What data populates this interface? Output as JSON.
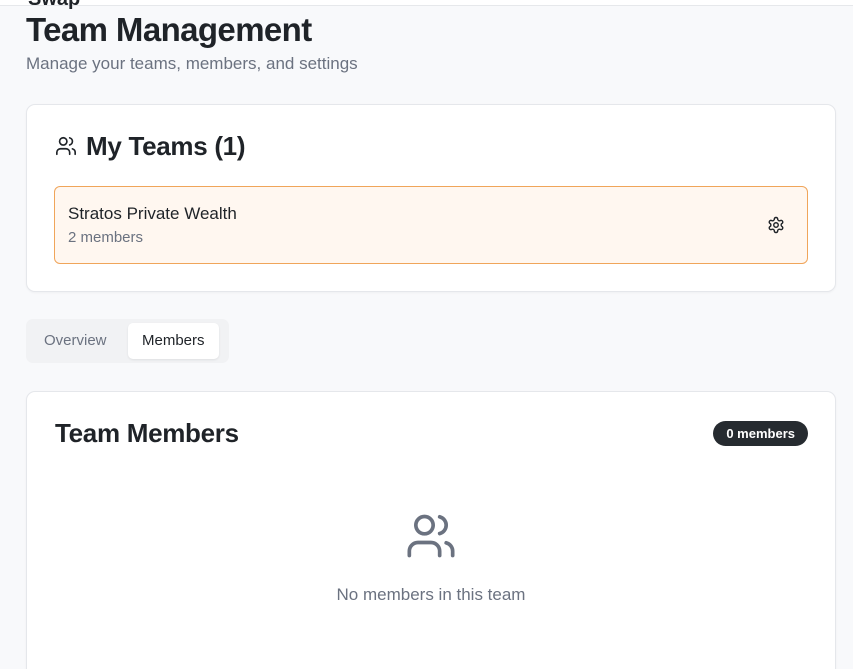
{
  "header": {
    "brand": "Swap",
    "title": "Team Management",
    "subtitle": "Manage your teams, members, and settings"
  },
  "my_teams": {
    "title": "My Teams (1)",
    "icon": "users-icon",
    "teams": [
      {
        "name": "Stratos Private Wealth",
        "members": "2 members",
        "selected": true
      }
    ]
  },
  "tabs": {
    "items": [
      {
        "label": "Overview",
        "active": false
      },
      {
        "label": "Members",
        "active": true
      }
    ]
  },
  "team_members": {
    "title": "Team Members",
    "badge": "0 members",
    "empty_icon": "users-icon",
    "empty_text": "No members in this team"
  },
  "colors": {
    "accent_border": "#f0a55a",
    "selected_bg": "#fff7f0",
    "badge_bg": "#262b30",
    "muted_text": "#6b7280"
  }
}
